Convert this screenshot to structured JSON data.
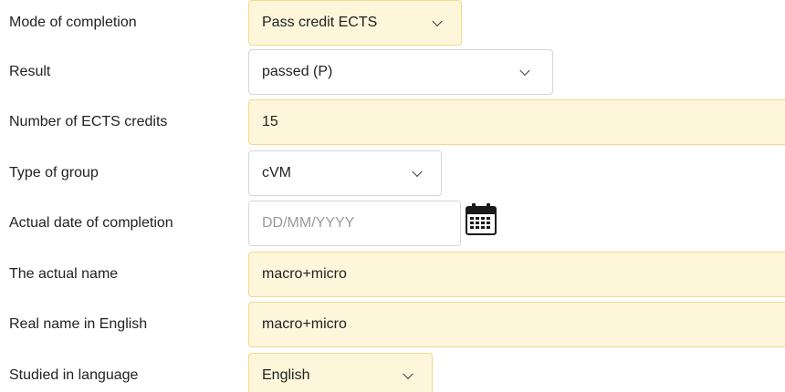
{
  "fields": {
    "mode_of_completion": {
      "label": "Mode of completion",
      "value": "Pass credit ECTS"
    },
    "result": {
      "label": "Result",
      "value": "passed (P)"
    },
    "ects_credits": {
      "label": "Number of ECTS credits",
      "value": "15"
    },
    "type_of_group": {
      "label": "Type of group",
      "value": "cVM"
    },
    "actual_date": {
      "label": "Actual date of completion",
      "value": "",
      "placeholder": "DD/MM/YYYY"
    },
    "actual_name": {
      "label": "The actual name",
      "value": "macro+micro"
    },
    "real_name_english": {
      "label": "Real name in English",
      "value": "macro+micro"
    },
    "studied_language": {
      "label": "Studied in language",
      "value": "English"
    }
  },
  "icons": {
    "dropdown": "chevron-down-icon",
    "date_picker": "calendar-icon"
  },
  "colors": {
    "highlight_fill": "#fdf6da",
    "highlight_border": "#f2d98c",
    "border": "#d6d6d6",
    "placeholder": "#9a9a9a",
    "text": "#222222"
  }
}
